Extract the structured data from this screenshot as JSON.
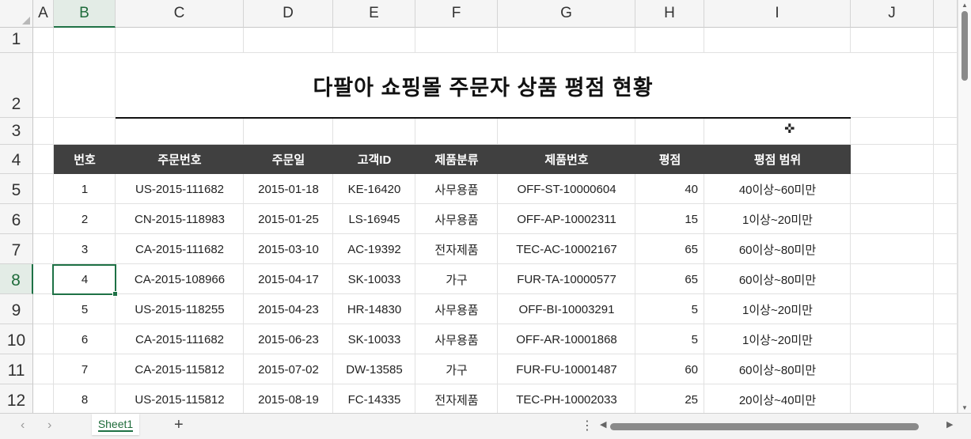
{
  "columns": [
    "A",
    "B",
    "C",
    "D",
    "E",
    "F",
    "G",
    "H",
    "I",
    "J"
  ],
  "selected_column": "B",
  "rows": [
    "1",
    "2",
    "3",
    "4",
    "5",
    "6",
    "7",
    "8",
    "9",
    "10",
    "11",
    "12"
  ],
  "selected_row": "8",
  "title": "다팔아 쇼핑몰 주문자 상품 평점 현황",
  "table": {
    "headers": [
      "번호",
      "주문번호",
      "주문일",
      "고객ID",
      "제품분류",
      "제품번호",
      "평점",
      "평점 범위"
    ],
    "rows": [
      [
        "1",
        "US-2015-111682",
        "2015-01-18",
        "KE-16420",
        "사무용품",
        "OFF-ST-10000604",
        "40",
        "40이상~60미만"
      ],
      [
        "2",
        "CN-2015-118983",
        "2015-01-25",
        "LS-16945",
        "사무용품",
        "OFF-AP-10002311",
        "15",
        "1이상~20미만"
      ],
      [
        "3",
        "CA-2015-111682",
        "2015-03-10",
        "AC-19392",
        "전자제품",
        "TEC-AC-10002167",
        "65",
        "60이상~80미만"
      ],
      [
        "4",
        "CA-2015-108966",
        "2015-04-17",
        "SK-10033",
        "가구",
        "FUR-TA-10000577",
        "65",
        "60이상~80미만"
      ],
      [
        "5",
        "US-2015-118255",
        "2015-04-23",
        "HR-14830",
        "사무용품",
        "OFF-BI-10003291",
        "5",
        "1이상~20미만"
      ],
      [
        "6",
        "CA-2015-111682",
        "2015-06-23",
        "SK-10033",
        "사무용품",
        "OFF-AR-10001868",
        "5",
        "1이상~20미만"
      ],
      [
        "7",
        "CA-2015-115812",
        "2015-07-02",
        "DW-13585",
        "가구",
        "FUR-FU-10001487",
        "60",
        "60이상~80미만"
      ],
      [
        "8",
        "US-2015-115812",
        "2015-08-19",
        "FC-14335",
        "전자제품",
        "TEC-PH-10002033",
        "25",
        "20이상~40미만"
      ]
    ]
  },
  "footer": {
    "sheet_tab": "Sheet1",
    "add_sheet": "+",
    "more": "⋮",
    "nav_prev": "‹",
    "nav_next": "›"
  },
  "icons": {
    "cursor": "cross-cursor-icon"
  },
  "colors": {
    "header_bg": "#404040",
    "selection": "#1e7145"
  }
}
